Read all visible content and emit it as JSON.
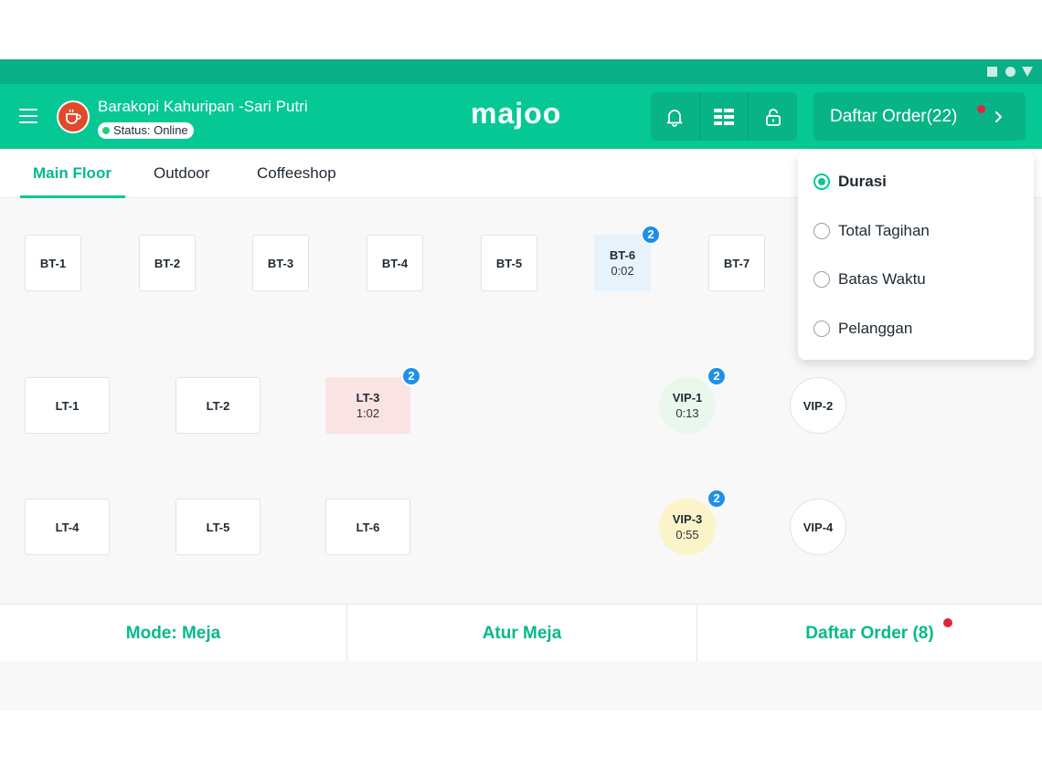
{
  "header": {
    "store_name": "Barakopi Kahuripan -Sari Putri",
    "status": "Status: Online",
    "brand": "majoo",
    "order_button": "Daftar Order(22)",
    "icons": [
      "menu-icon",
      "bell-icon",
      "grid-icon",
      "unlock-icon",
      "chevron-right-icon"
    ]
  },
  "tabs": [
    "Main Floor",
    "Outdoor",
    "Coffeeshop"
  ],
  "active_tab": "Main Floor",
  "tables": {
    "bt1": {
      "name": "BT-1"
    },
    "bt2": {
      "name": "BT-2"
    },
    "bt3": {
      "name": "BT-3"
    },
    "bt4": {
      "name": "BT-4"
    },
    "bt5": {
      "name": "BT-5"
    },
    "bt6": {
      "name": "BT-6",
      "time": "0:02",
      "badge": "2"
    },
    "bt7": {
      "name": "BT-7"
    },
    "lt1": {
      "name": "LT-1"
    },
    "lt2": {
      "name": "LT-2"
    },
    "lt3": {
      "name": "LT-3",
      "time": "1:02",
      "badge": "2"
    },
    "lt4": {
      "name": "LT-4"
    },
    "lt5": {
      "name": "LT-5"
    },
    "lt6": {
      "name": "LT-6"
    },
    "vip1": {
      "name": "VIP-1",
      "time": "0:13",
      "badge": "2"
    },
    "vip2": {
      "name": "VIP-2"
    },
    "vip3": {
      "name": "VIP-3",
      "time": "0:55",
      "badge": "2"
    },
    "vip4": {
      "name": "VIP-4"
    }
  },
  "sort_menu": {
    "options": [
      "Durasi",
      "Total Tagihan",
      "Batas Waktu",
      "Pelanggan"
    ],
    "selected": "Durasi"
  },
  "bottom": {
    "mode": "Mode: Meja",
    "atur": "Atur Meja",
    "orders": "Daftar Order (8)"
  },
  "colors": {
    "primary": "#05c895",
    "system_bar": "#0aaf87",
    "badge": "#1e90e8",
    "notification_dot": "#e0253a",
    "table_blue": "#e6f3fd",
    "table_red": "#fae3e3",
    "table_green": "#eaf7ec",
    "table_yellow": "#fbf4c9"
  }
}
